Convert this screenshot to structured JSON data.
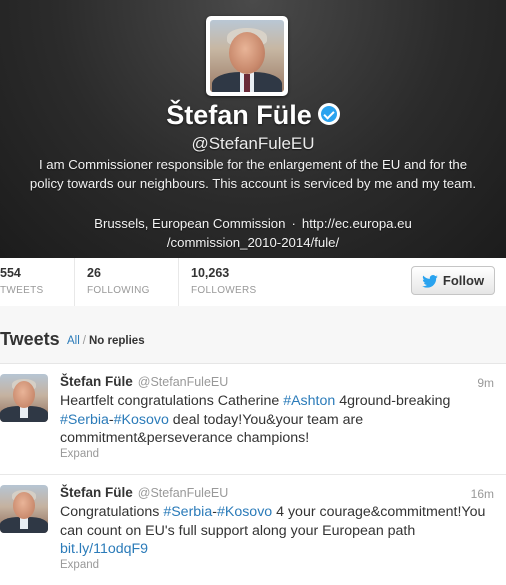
{
  "profile": {
    "name": "Štefan Füle",
    "handle": "@StefanFuleEU",
    "bio": "I am Commissioner responsible for the enlargement of the EU and for the policy towards our neighbours. This account is serviced by me and my team.",
    "location": "Brussels, European Commission",
    "separator": "·",
    "url_line1": "http://ec.europa.eu",
    "url_line2": "/commission_2010-2014/fule/",
    "verified_icon": "verified-badge-icon"
  },
  "stats": [
    {
      "value": "554",
      "label": "TWEETS"
    },
    {
      "value": "26",
      "label": "FOLLOWING"
    },
    {
      "value": "10,263",
      "label": "FOLLOWERS"
    }
  ],
  "follow_button": {
    "label": "Follow",
    "icon": "twitter-bird-icon"
  },
  "timeline": {
    "title": "Tweets",
    "all_label": "All",
    "slash": "/",
    "no_replies_label": "No replies"
  },
  "tweets": [
    {
      "author": "Štefan Füle",
      "handle": "@StefanFuleEU",
      "time": "9m",
      "text_parts": [
        {
          "t": "Heartfelt congratulations Catherine ",
          "link": false
        },
        {
          "t": "#Ashton",
          "link": true
        },
        {
          "t": " 4ground-breaking ",
          "link": false
        },
        {
          "t": "#Serbia",
          "link": true
        },
        {
          "t": "-",
          "link": false
        },
        {
          "t": "#Kosovo",
          "link": true
        },
        {
          "t": " deal today!You&your team are commitment&perseverance champions!",
          "link": false
        }
      ],
      "expand": "Expand"
    },
    {
      "author": "Štefan Füle",
      "handle": "@StefanFuleEU",
      "time": "16m",
      "text_parts": [
        {
          "t": "Congratulations ",
          "link": false
        },
        {
          "t": "#Serbia",
          "link": true
        },
        {
          "t": "-",
          "link": false
        },
        {
          "t": "#Kosovo",
          "link": true
        },
        {
          "t": " 4 your courage&commitment!You can count on EU's full support along your European path ",
          "link": false
        },
        {
          "t": "bit.ly/11odqF9",
          "link": true
        }
      ],
      "expand": "Expand"
    }
  ]
}
